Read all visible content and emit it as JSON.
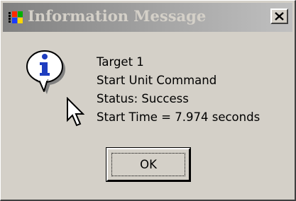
{
  "window": {
    "title": "Information Message",
    "close_label": "×"
  },
  "icons": {
    "app": "windows-flag-icon",
    "close": "close-icon",
    "info": "information-icon",
    "cursor": "mouse-pointer-icon"
  },
  "message": {
    "lines": [
      "Target 1",
      "Start Unit Command",
      "Status: Success",
      "Start Time = 7.974 seconds"
    ]
  },
  "buttons": {
    "ok_label": "OK"
  },
  "colors": {
    "face": "#d4d0c8",
    "title_active_start": "#808080",
    "title_active_end": "#c0c0c0",
    "title_text": "#d4d0c8",
    "info_blue": "#1e3dbf"
  }
}
